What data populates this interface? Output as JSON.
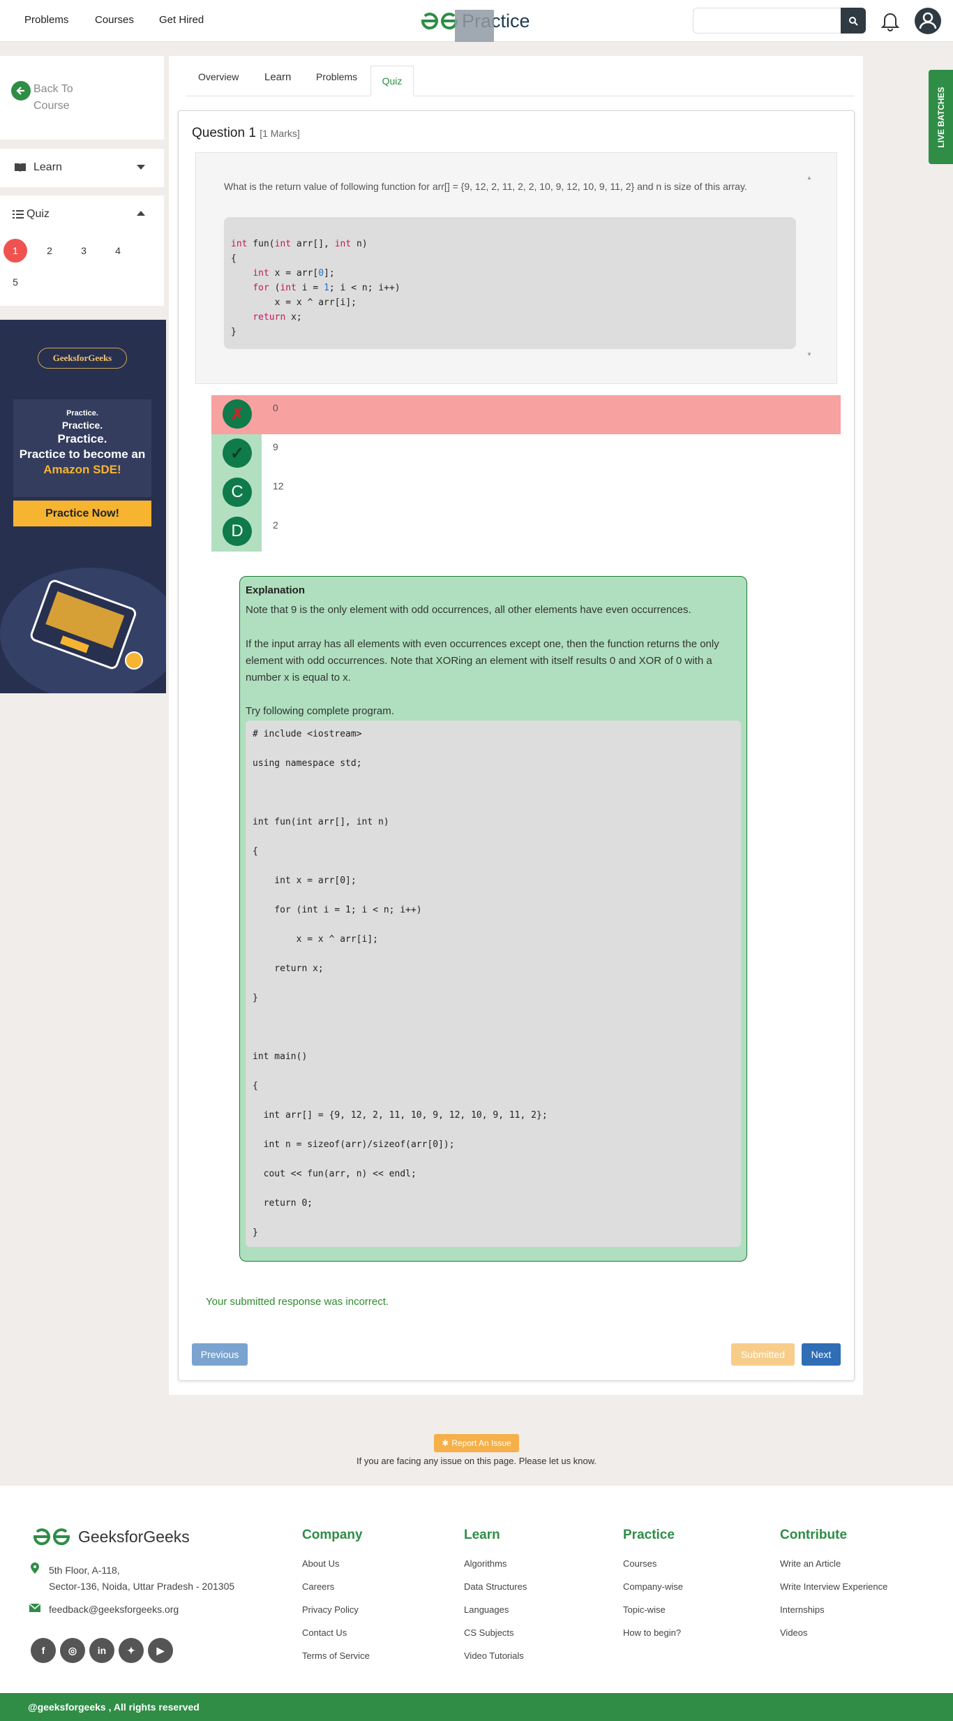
{
  "header": {
    "nav": [
      "Problems",
      "Courses",
      "Get Hired"
    ],
    "logo_text": "Practice",
    "search_placeholder": ""
  },
  "sidebar": {
    "back_label": "Back To Course",
    "learn_label": "Learn",
    "quiz_label": "Quiz",
    "quiz_numbers": [
      "1",
      "2",
      "3",
      "4",
      "5"
    ],
    "active_question": "1"
  },
  "ad": {
    "brand": "GeeksforGeeks",
    "line1": "Practice.",
    "line2": "Practice.",
    "line3": "Practice.",
    "line4": "Practice to become an",
    "line5": "Amazon SDE!",
    "cta": "Practice Now!"
  },
  "tabs": [
    "Overview",
    "Learn",
    "Problems",
    "Quiz"
  ],
  "question": {
    "title": "Question 1",
    "marks": "[1 Marks]",
    "text": "What is the return value of following function for arr[] = {9, 12, 2, 11, 2, 2, 10, 9, 12, 10, 9, 11, 2} and n is size of this array.",
    "code": [
      "int fun(int arr[], int n)",
      "{",
      "    int x = arr[0];",
      "    for (int i = 1; i < n; i++)",
      "        x = x ^ arr[i];",
      "    return x;",
      "}"
    ]
  },
  "options": [
    {
      "badge": "✗",
      "value": "0",
      "state": "wrong"
    },
    {
      "badge": "✓",
      "value": "9",
      "state": "correct"
    },
    {
      "badge": "C",
      "value": "12",
      "state": "none"
    },
    {
      "badge": "D",
      "value": "2",
      "state": "none"
    }
  ],
  "explanation": {
    "title": "Explanation",
    "p1": "Note that 9 is the only element with odd occurrences, all other elements have even occurrences.",
    "p2": "If the input array has all elements with even occurrences except one, then the function returns the only element with odd occurrences. Note that XORing an element with itself results 0 and XOR of 0 with a number x is equal to x.",
    "p3": "Try following complete program.",
    "code": [
      "# include <iostream>",
      "using namespace std;",
      "",
      "int fun(int arr[], int n)",
      "{",
      "    int x = arr[0];",
      "    for (int i = 1; i < n; i++)",
      "        x = x ^ arr[i];",
      "    return x;",
      "}",
      "",
      "int main()",
      "{",
      "  int arr[] = {9, 12, 2, 11, 10, 9, 12, 10, 9, 11, 2};",
      "  int n = sizeof(arr)/sizeof(arr[0]);",
      "  cout << fun(arr, n) << endl;",
      "  return 0;",
      "}"
    ]
  },
  "response_text": "Your submitted response was incorrect.",
  "buttons": {
    "previous": "Previous",
    "submitted": "Submitted",
    "next": "Next"
  },
  "live_batches": "LIVE BATCHES",
  "report": {
    "button": "Report An Issue",
    "text": "If you are facing any issue on this page. Please let us know."
  },
  "footer": {
    "brand": "GeeksforGeeks",
    "address1": "5th Floor, A-118,",
    "address2": "Sector-136, Noida, Uttar Pradesh - 201305",
    "email": "feedback@geeksforgeeks.org",
    "columns": [
      {
        "head": "Company",
        "links": [
          "About Us",
          "Careers",
          "Privacy Policy",
          "Contact Us",
          "Terms of Service"
        ]
      },
      {
        "head": "Learn",
        "links": [
          "Algorithms",
          "Data Structures",
          "Languages",
          "CS Subjects",
          "Video Tutorials"
        ]
      },
      {
        "head": "Practice",
        "links": [
          "Courses",
          "Company-wise",
          "Topic-wise",
          "How to begin?"
        ]
      },
      {
        "head": "Contribute",
        "links": [
          "Write an Article",
          "Write Interview Experience",
          "Internships",
          "Videos"
        ]
      }
    ],
    "social": [
      "facebook-icon",
      "instagram-icon",
      "linkedin-icon",
      "twitter-icon",
      "youtube-icon"
    ],
    "copyright": "@geeksforgeeks , All rights reserved"
  },
  "colors": {
    "brand_green": "#2f8d46",
    "wrong_red": "#f8a1a1",
    "correct_green": "#b2dfc0"
  }
}
